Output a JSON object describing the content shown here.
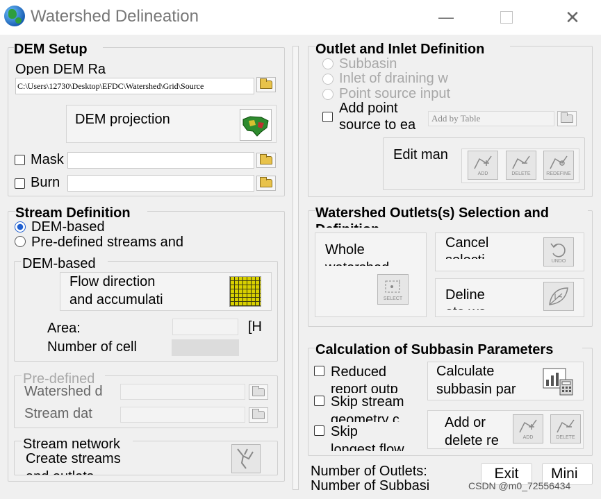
{
  "window": {
    "title": "Watershed Delineation",
    "min": "—",
    "close": "✕"
  },
  "dem_setup": {
    "title": "DEM Setup",
    "open_label": "Open DEM Ra",
    "path": "C:\\Users\\12730\\Desktop\\EFDC\\Watershed\\Grid\\Source",
    "projection": "DEM projection",
    "mask": "Mask",
    "burn": "Burn"
  },
  "stream_def": {
    "title": "Stream Definition",
    "opt_dem": "DEM-based",
    "opt_pre": "Pre-defined streams and",
    "dem_group": "DEM-based",
    "flow_btn1": "Flow direction",
    "flow_btn2": "and accumulati",
    "area": "Area:",
    "area_unit": "[H",
    "cells": "Number of cell",
    "pre_group": "Pre-defined",
    "watershed": "Watershed d",
    "stream": "Stream dat",
    "network_group": "Stream network",
    "create1": "Create streams",
    "create2": "and outlets"
  },
  "outlet": {
    "title": "Outlet and Inlet Definition",
    "subbasin": "Subbasin",
    "inlet": "Inlet of draining w",
    "point": "Point source input",
    "add1": "Add point",
    "add2": "source to ea",
    "add_table": "Add by Table",
    "edit": "Edit man",
    "add_icon": "ADD",
    "delete_icon": "DELETE",
    "redefine_icon": "REDEFINE"
  },
  "selection": {
    "title": "Watershed Outlets(s) Selection and",
    "title2": "Definition",
    "whole1": "Whole",
    "whole2": "watershed",
    "select_icon": "SELECT",
    "cancel1": "Cancel",
    "cancel2": "selecti",
    "undo_icon": "UNDO",
    "deline1": "Deline",
    "deline2": "ate wa"
  },
  "calc": {
    "title": "Calculation of Subbasin Parameters",
    "reduced1": "Reduced",
    "reduced2": "report outp",
    "skip1a": "Skip stream",
    "skip1b": "geometry c",
    "skip2a": "Skip",
    "skip2b": "longest flow",
    "calc1": "Calculate",
    "calc2": "subbasin par",
    "addor1": "Add or",
    "addor2": "delete re",
    "add_icon": "ADD",
    "delete_icon": "DELETE"
  },
  "footer": {
    "outlets": "Number of Outlets:",
    "subbasins": "Number of Subbasi",
    "exit": "Exit",
    "mini": "Mini"
  },
  "watermark": "CSDN @m0_72556434"
}
